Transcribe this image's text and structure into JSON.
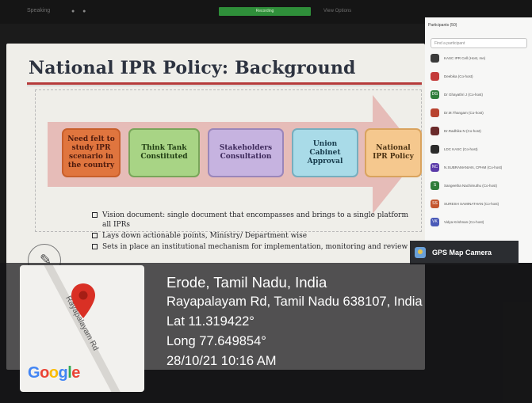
{
  "meeting": {
    "top_left_label": "Speaking",
    "recording_label": "Recording",
    "view_options_label": "View Options"
  },
  "slide": {
    "title": "National IPR Policy: Background",
    "steps": [
      "Need felt to study IPR scenario in the country",
      "Think Tank Constituted",
      "Stakeholders Consultation",
      "Union Cabinet Approval",
      "National IPR Policy"
    ],
    "bullets": [
      "Vision document: single document that encompasses and brings to a single platform all IPRs",
      "Lays down actionable points, Ministry/ Department wise",
      "Sets in place an institutional mechanism for implementation, monitoring and review"
    ]
  },
  "participants": {
    "header": "Participants (50)",
    "search_placeholder": "Find a participant",
    "items": [
      {
        "name": "KASC IPR Cell (Host, me)",
        "initials": "",
        "color": "#3b3b3b"
      },
      {
        "name": "Deebika (Co-host)",
        "initials": "",
        "color": "#c43b3b"
      },
      {
        "name": "Dr Ghayathri J (Co-host)",
        "initials": "DG",
        "color": "#2f7d3a"
      },
      {
        "name": "Dr.M.Thangam (Co-host)",
        "initials": "",
        "color": "#b8432f"
      },
      {
        "name": "Dr.Radhika N (Co-host)",
        "initials": "",
        "color": "#6b2b2b"
      },
      {
        "name": "LDC KASC (Co-host)",
        "initials": "",
        "color": "#2b2b2b"
      },
      {
        "name": "N.SUBRAMANIAN, CPHM (Co-host)",
        "initials": "NC",
        "color": "#5a3aa8"
      },
      {
        "name": "Sangeetha Nachimuthu (Co-host)",
        "initials": "S",
        "color": "#2f7d3a"
      },
      {
        "name": "SURESH SAMINATHAN (Co-host)",
        "initials": "SS",
        "color": "#c4562f"
      },
      {
        "name": "Vidya Krishnan (Co-host)",
        "initials": "VK",
        "color": "#4a5ab8"
      }
    ]
  },
  "gps_app_label": "GPS Map Camera",
  "location": {
    "city": "Erode, Tamil Nadu, India",
    "address": "Rayapalayam Rd, Tamil Nadu 638107, India",
    "lat": "Lat 11.319422°",
    "long": "Long 77.649854°",
    "datetime": "28/10/21 10:16 AM"
  },
  "map": {
    "road_label": "Rayapalayam Rd",
    "provider_logo": "Google"
  },
  "colors": {
    "title_rule": "#b53a3a",
    "pin": "#d93025"
  }
}
